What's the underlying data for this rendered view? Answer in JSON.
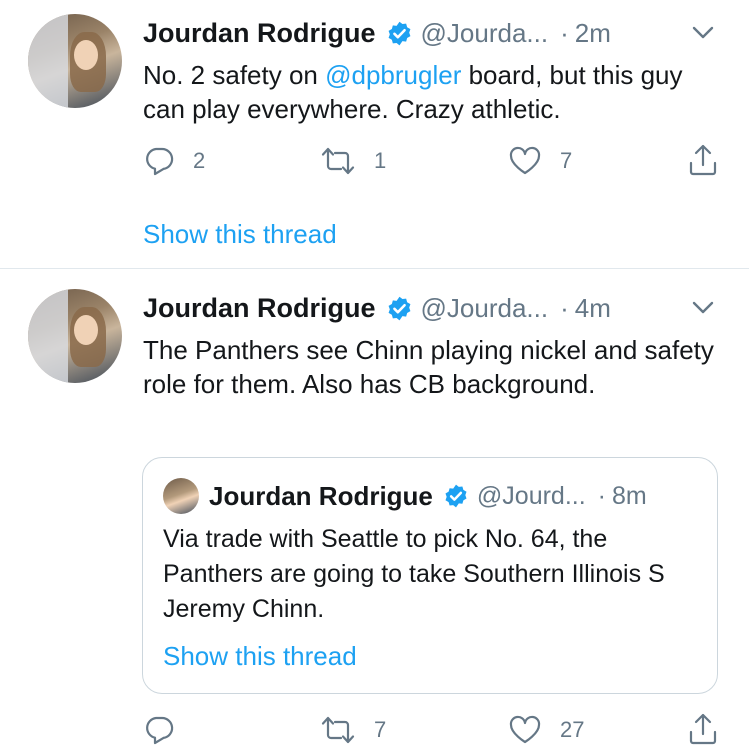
{
  "tweets": [
    {
      "author": {
        "name": "Jourdan Rodrigue",
        "handle": "@Jourda...",
        "verified": true
      },
      "time": "2m",
      "text_before": "No. 2 safety on ",
      "mention": "@dpbrugler",
      "text_after": " board, but this guy can play everywhere. Crazy athletic.",
      "replies": "2",
      "retweets": "1",
      "likes": "7",
      "thread_link": "Show this thread"
    },
    {
      "author": {
        "name": "Jourdan Rodrigue",
        "handle": "@Jourda...",
        "verified": true
      },
      "time": "4m",
      "text": "The Panthers see Chinn playing nickel and safety role for them. Also has CB background.",
      "quoted": {
        "author": {
          "name": "Jourdan Rodrigue",
          "handle": "@Jourd...",
          "verified": true
        },
        "time": "8m",
        "text": "Via trade with Seattle to pick No. 64, the Panthers are going to take Southern Illinois S Jeremy Chinn.",
        "thread_link": "Show this thread"
      },
      "replies": "",
      "retweets": "7",
      "likes": "27"
    }
  ],
  "colors": {
    "accent": "#1da1f2",
    "secondary_text": "#657786",
    "divider": "#e1e8ed"
  },
  "icons": [
    "verified-badge-icon",
    "chevron-down-icon",
    "reply-icon",
    "retweet-icon",
    "like-icon",
    "share-icon"
  ],
  "separator": "·"
}
